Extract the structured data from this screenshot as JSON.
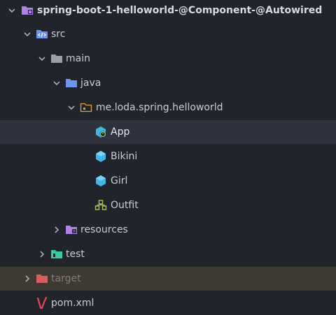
{
  "project": {
    "root": "spring-boot-1-helloworld-@Component-@Autowired",
    "src": "src",
    "main": "main",
    "java": "java",
    "package": "me.loda.spring.helloworld",
    "classes": {
      "app": "App",
      "bikini": "Bikini",
      "girl": "Girl",
      "outfit": "Outfit"
    },
    "resources": "resources",
    "test": "test",
    "target": "target",
    "pom": "pom.xml"
  },
  "colors": {
    "background": "#21252b",
    "selected_row": "#2f333d",
    "excluded_row": "#3d3a33",
    "folder_blue": "#6c95eb",
    "folder_gray": "#9aa0a8",
    "module_purple": "#b180e8",
    "test_green": "#3cc9a0",
    "target_red": "#d65d5d",
    "class_cyan": "#3fb5e8",
    "package_orange": "#d9a24a",
    "maven_red": "#e8445b",
    "outfit_green": "#a7c54a"
  },
  "icons": {
    "root": "module-folder-icon",
    "src": "source-folder-icon",
    "main": "folder-icon",
    "java": "folder-icon",
    "package": "package-icon",
    "class": "class-icon",
    "spring": "spring-class-icon",
    "outfit": "interface-icon",
    "resources": "resources-folder-icon",
    "test": "test-folder-icon",
    "target": "excluded-folder-icon",
    "pom": "maven-icon",
    "expanded": "chevron-down-icon",
    "collapsed": "chevron-right-icon"
  }
}
